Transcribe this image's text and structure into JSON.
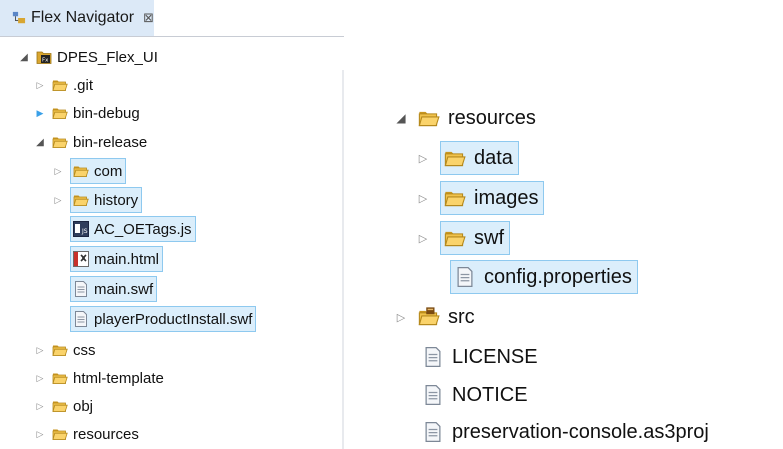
{
  "navigator": {
    "tab_title": "Flex Navigator",
    "tab_close": "⊠",
    "tree": [
      {
        "label": "DPES_Flex_UI",
        "icon": "flex-project-icon",
        "state": "open",
        "level": 0
      },
      {
        "label": ".git",
        "icon": "folder-icon",
        "state": "closed",
        "level": 1
      },
      {
        "label": "bin-debug",
        "icon": "folder-icon",
        "state": "closed-blue",
        "level": 1
      },
      {
        "label": "bin-release",
        "icon": "folder-icon",
        "state": "open",
        "level": 1
      },
      {
        "label": "com",
        "icon": "folder-icon",
        "state": "closed",
        "level": 2,
        "selected": true
      },
      {
        "label": "history",
        "icon": "folder-icon",
        "state": "closed",
        "level": 2,
        "selected": true
      },
      {
        "label": "AC_OETags.js",
        "icon": "js-file-icon",
        "state": "none",
        "level": 2,
        "selected": true
      },
      {
        "label": "main.html",
        "icon": "html-file-icon",
        "state": "none",
        "level": 2,
        "selected": true
      },
      {
        "label": "main.swf",
        "icon": "file-icon",
        "state": "none",
        "level": 2,
        "selected": true
      },
      {
        "label": "playerProductInstall.swf",
        "icon": "file-icon",
        "state": "none",
        "level": 2,
        "selected": true
      },
      {
        "label": "css",
        "icon": "folder-icon",
        "state": "closed",
        "level": 1
      },
      {
        "label": "html-template",
        "icon": "folder-icon",
        "state": "closed",
        "level": 1
      },
      {
        "label": "obj",
        "icon": "folder-icon",
        "state": "closed",
        "level": 1
      },
      {
        "label": "resources",
        "icon": "folder-icon",
        "state": "closed",
        "level": 1
      }
    ]
  },
  "zoomed": {
    "tree": [
      {
        "label": "resources",
        "icon": "folder-icon",
        "state": "open",
        "level": 0
      },
      {
        "label": "data",
        "icon": "folder-icon",
        "state": "closed",
        "level": 1,
        "selected": true
      },
      {
        "label": "images",
        "icon": "folder-icon",
        "state": "closed",
        "level": 1,
        "selected": true
      },
      {
        "label": "swf",
        "icon": "folder-icon",
        "state": "closed",
        "level": 1,
        "selected": true
      },
      {
        "label": "config.properties",
        "icon": "file-icon",
        "state": "none",
        "level": 1,
        "selected": true
      },
      {
        "label": "src",
        "icon": "source-folder-icon",
        "state": "closed",
        "level": 0
      },
      {
        "label": "LICENSE",
        "icon": "file-icon",
        "state": "none",
        "level": 0
      },
      {
        "label": "NOTICE",
        "icon": "file-icon",
        "state": "none",
        "level": 0
      },
      {
        "label": "preservation-console.as3proj",
        "icon": "file-icon",
        "state": "none",
        "level": 0
      }
    ]
  },
  "colors": {
    "selection_bg": "#dbeefb",
    "selection_border": "#8ec9ef",
    "folder": "#e8b93a",
    "tab_active": "#dce9f7"
  }
}
